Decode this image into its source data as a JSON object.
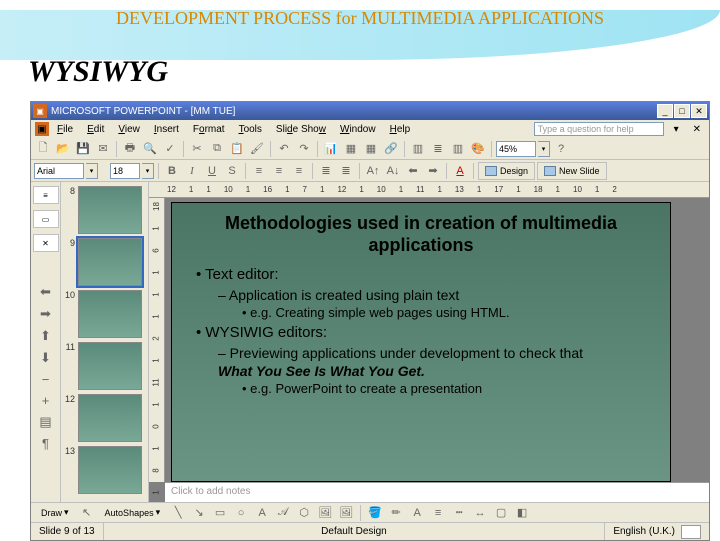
{
  "presentation": {
    "header_title": "DEVELOPMENT PROCESS for MULTIMEDIA APPLICATIONS",
    "header_subtitle": "WYSIWYG"
  },
  "titlebar": {
    "app": "MICROSOFT POWERPOINT",
    "doc": "[MM TUE]"
  },
  "menu": {
    "file": "File",
    "edit": "Edit",
    "view": "View",
    "insert": "Insert",
    "format": "Format",
    "tools": "Tools",
    "slideshow": "Slide Show",
    "window": "Window",
    "help": "Help",
    "help_placeholder": "Type a question for help"
  },
  "toolbar": {
    "zoom": "45%",
    "font": "Arial",
    "size": "18",
    "design": "Design",
    "newslide": "New Slide"
  },
  "ruler_h": [
    "12",
    "1",
    "1",
    "10",
    "1",
    "16",
    "1",
    "7",
    "1",
    "12",
    "1",
    "10",
    "1",
    "11",
    "1",
    "13",
    "1",
    "17",
    "1",
    "18",
    "1",
    "10",
    "1",
    "2"
  ],
  "ruler_v": [
    "18",
    "1",
    "6",
    "1",
    "1",
    "1",
    "2",
    "1",
    "11",
    "1",
    "0",
    "1",
    "8",
    "1"
  ],
  "thumbs": [
    {
      "n": "8"
    },
    {
      "n": "9",
      "sel": true
    },
    {
      "n": "10"
    },
    {
      "n": "11"
    },
    {
      "n": "12"
    },
    {
      "n": "13"
    }
  ],
  "slide": {
    "title": "Methodologies used in creation of multimedia applications",
    "items": [
      {
        "lvl": 0,
        "text": "• Text editor:"
      },
      {
        "lvl": 1,
        "text": "– Application is created using plain text"
      },
      {
        "lvl": 2,
        "text": "• e.g. Creating simple web pages using HTML."
      },
      {
        "lvl": 0,
        "text": "• WYSIWIG editors:"
      },
      {
        "lvl": 1,
        "text": "– Previewing applications under development to check that "
      },
      {
        "lvl": 1,
        "em": true,
        "text": "What You See Is What You Get."
      },
      {
        "lvl": 2,
        "text": "• e.g. PowerPoint to create a presentation"
      }
    ]
  },
  "notes_placeholder": "Click to add notes",
  "drawbar": {
    "draw": "Draw",
    "autoshapes": "AutoShapes"
  },
  "status": {
    "slide": "Slide 9 of 13",
    "design": "Default Design",
    "lang": "English (U.K.)"
  },
  "icons": {
    "new": "🗋",
    "open": "📂",
    "save": "💾",
    "mail": "✉",
    "print": "🖶",
    "preview": "🔍",
    "spell": "✓",
    "cut": "✂",
    "copy": "⧉",
    "paste": "📋",
    "brush": "🖌",
    "undo": "↶",
    "redo": "↷",
    "chart": "📊",
    "table": "▦",
    "hyperlink": "🔗",
    "chartbar": "📈",
    "show": "▦",
    "grid": "▥",
    "color": "🎨",
    "zoom": "🔍",
    "help": "?",
    "bold": "B",
    "italic": "I",
    "underline": "U",
    "shadow": "S",
    "left": "≡",
    "center": "≡",
    "right": "≡",
    "bullets": "≣",
    "numbers": "≣",
    "inc": "A↑",
    "dec": "A↓",
    "promote": "⬅",
    "demote": "➡",
    "fontcolor": "A",
    "pointer": "↖",
    "line": "╲",
    "arrow": "↘",
    "rect": "▭",
    "oval": "○",
    "text": "A",
    "wordart": "𝒜",
    "diagram": "⬡",
    "clipart": "🖼",
    "pic": "🖼",
    "fill": "🪣",
    "linecolor": "✏",
    "fontc": "A",
    "linew": "≡",
    "dash": "┅",
    "arrowstyle": "↔",
    "shadow2": "▢",
    "3d": "◧"
  }
}
